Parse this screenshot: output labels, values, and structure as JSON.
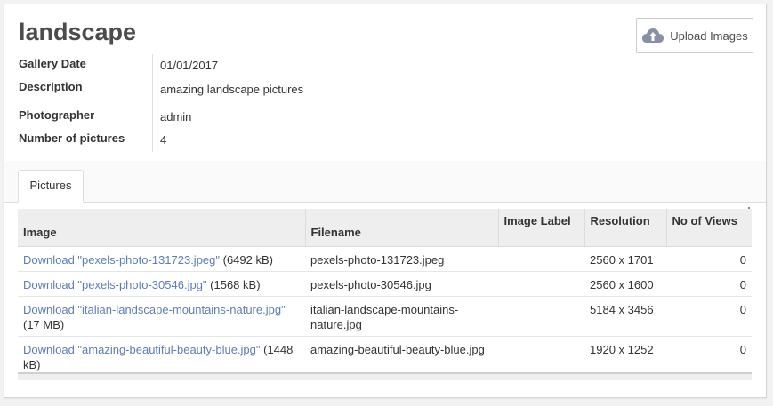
{
  "record": {
    "title": "landscape",
    "upload_label": "Upload Images",
    "fields": {
      "gallery_date_label": "Gallery Date",
      "gallery_date_value": "01/01/2017",
      "description_label": "Description",
      "description_value": "amazing landscape pictures",
      "photographer_label": "Photographer",
      "photographer_value": "admin",
      "count_label": "Number of pictures",
      "count_value": "4"
    }
  },
  "tabs": {
    "pictures": "Pictures"
  },
  "table": {
    "headers": {
      "image": "Image",
      "filename": "Filename",
      "image_label": "Image Label",
      "resolution": "Resolution",
      "views": "No of Views"
    },
    "rows": [
      {
        "link": "Download \"pexels-photo-131723.jpeg\"",
        "size": " (6492 kB)",
        "filename": "pexels-photo-131723.jpeg",
        "label": "",
        "resolution": "2560 x 1701",
        "views": "0"
      },
      {
        "link": "Download \"pexels-photo-30546.jpg\"",
        "size": " (1568 kB)",
        "filename": "pexels-photo-30546.jpg",
        "label": "",
        "resolution": "2560 x 1600",
        "views": "0"
      },
      {
        "link": "Download \"italian-landscape-mountains-nature.jpg\"",
        "size": " (17 MB)",
        "filename": "italian-landscape-mountains-nature.jpg",
        "label": "",
        "resolution": "5184 x 3456",
        "views": "0"
      },
      {
        "link": "Download \"amazing-beautiful-beauty-blue.jpg\"",
        "size": " (1448 kB)",
        "filename": "amazing-beautiful-beauty-blue.jpg",
        "label": "",
        "resolution": "1920 x 1252",
        "views": "0"
      }
    ]
  },
  "colors": {
    "link": "#5d7db8",
    "header_bg": "#eeeeee",
    "upload_icon": "#8a8fa8"
  },
  "icons": {
    "upload": "cloud-upload-icon"
  }
}
